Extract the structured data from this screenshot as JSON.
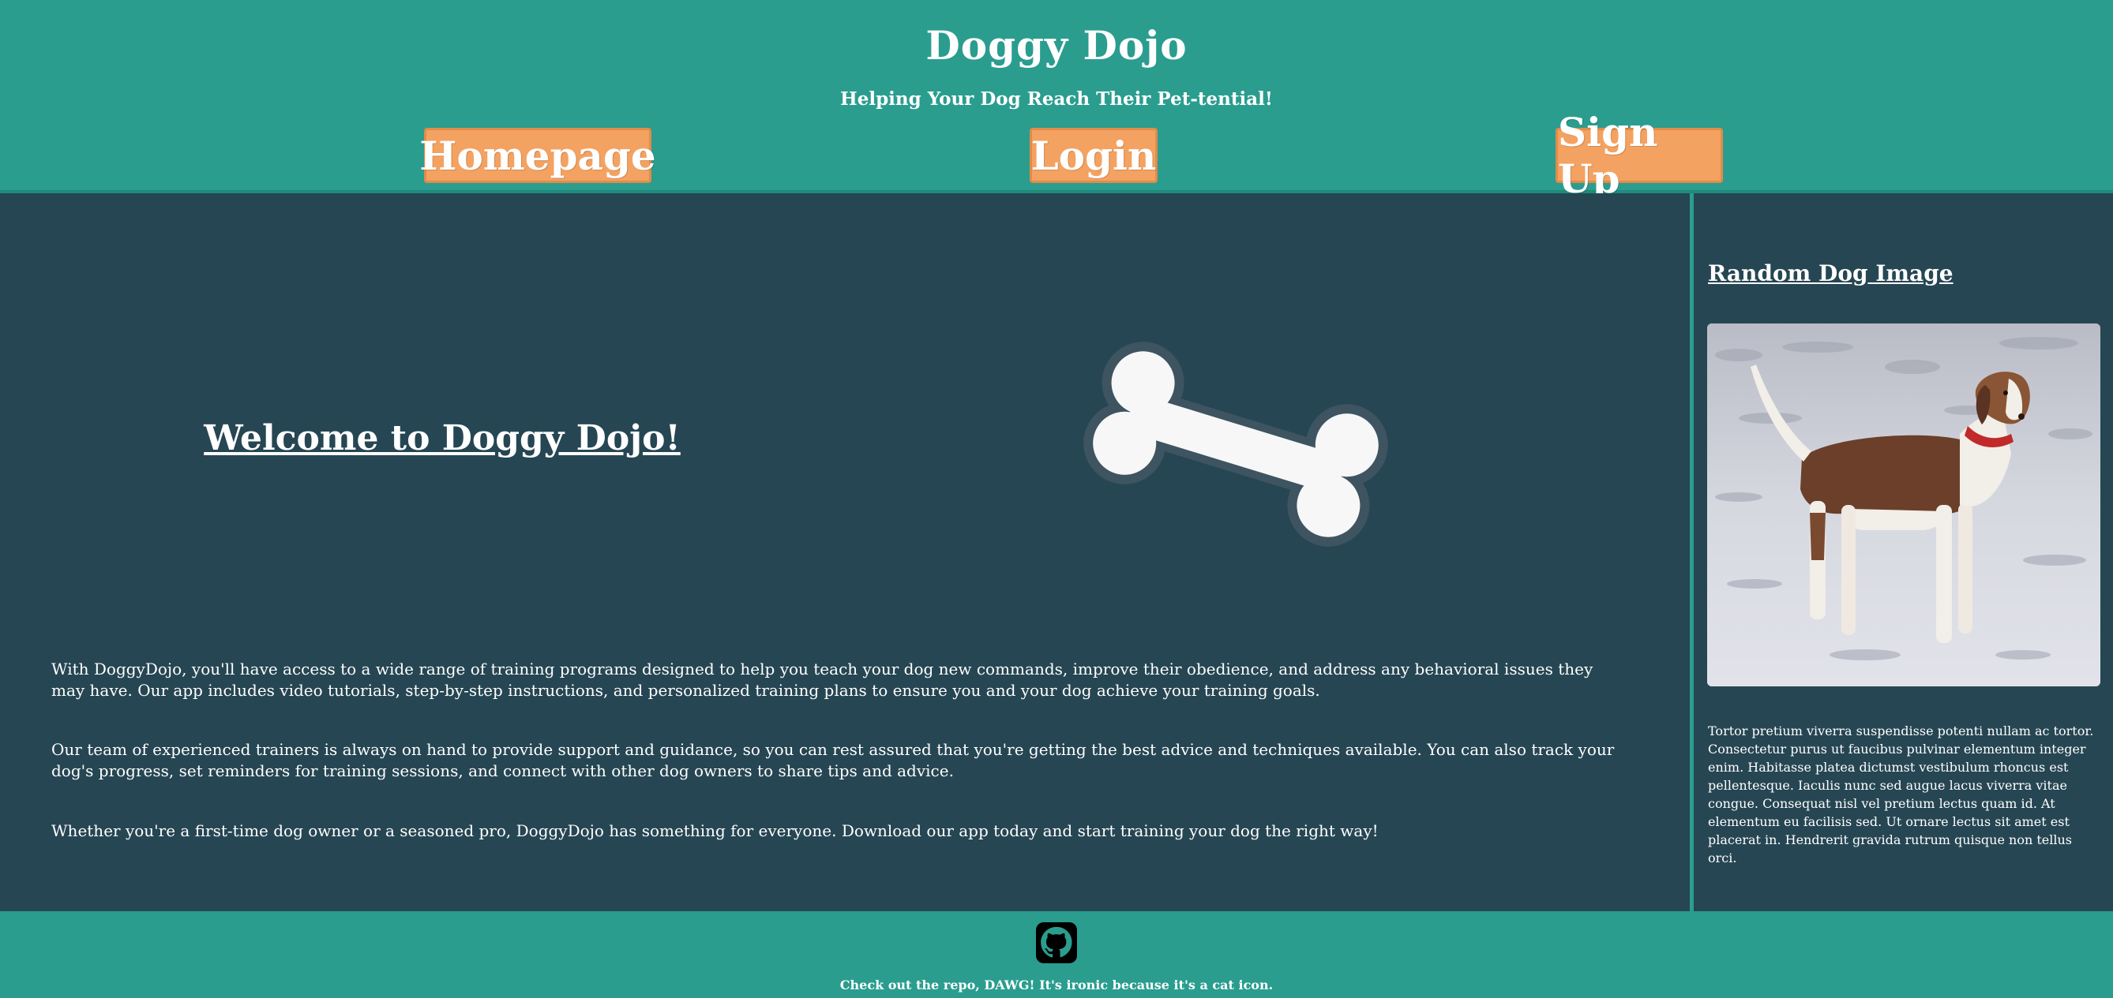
{
  "header": {
    "title": "Doggy Dojo",
    "tagline": "Helping Your Dog Reach Their Pet-tential!",
    "nav": {
      "home": "Homepage",
      "login": "Login",
      "signup": "Sign Up"
    }
  },
  "main": {
    "welcome": "Welcome to Doggy Dojo!",
    "icon": "bone-icon",
    "paragraphs": [
      "With DoggyDojo, you'll have access to a wide range of training programs designed to help you teach your dog new commands, improve their obedience, and address any behavioral issues they may have. Our app includes video tutorials, step-by-step instructions, and personalized training plans to ensure you and your dog achieve your training goals.",
      "Our team of experienced trainers is always on hand to provide support and guidance, so you can rest assured that you're getting the best advice and techniques available. You can also track your dog's progress, set reminders for training sessions, and connect with other dog owners to share tips and advice.",
      "Whether you're a first-time dog owner or a seasoned pro, DoggyDojo has something for everyone. Download our app today and start training your dog the right way!"
    ]
  },
  "aside": {
    "title": "Random Dog Image",
    "text": "Tortor pretium viverra suspendisse potenti nullam ac tortor. Consectetur purus ut faucibus pulvinar elementum integer enim. Habitasse platea dictumst vestibulum rhoncus est pellentesque. Iaculis nunc sed augue lacus viverra vitae congue. Consequat nisl vel pretium lectus quam id. At elementum eu facilisis sed. Ut ornare lectus sit amet est placerat in. Hendrerit gravida rutrum quisque non tellus orci."
  },
  "footer": {
    "icon": "github-icon",
    "text": "Check out the repo, DAWG! It's ironic because it's a cat icon."
  },
  "colors": {
    "teal": "#2a9d8f",
    "dark": "#264653",
    "orange": "#f4a261"
  }
}
